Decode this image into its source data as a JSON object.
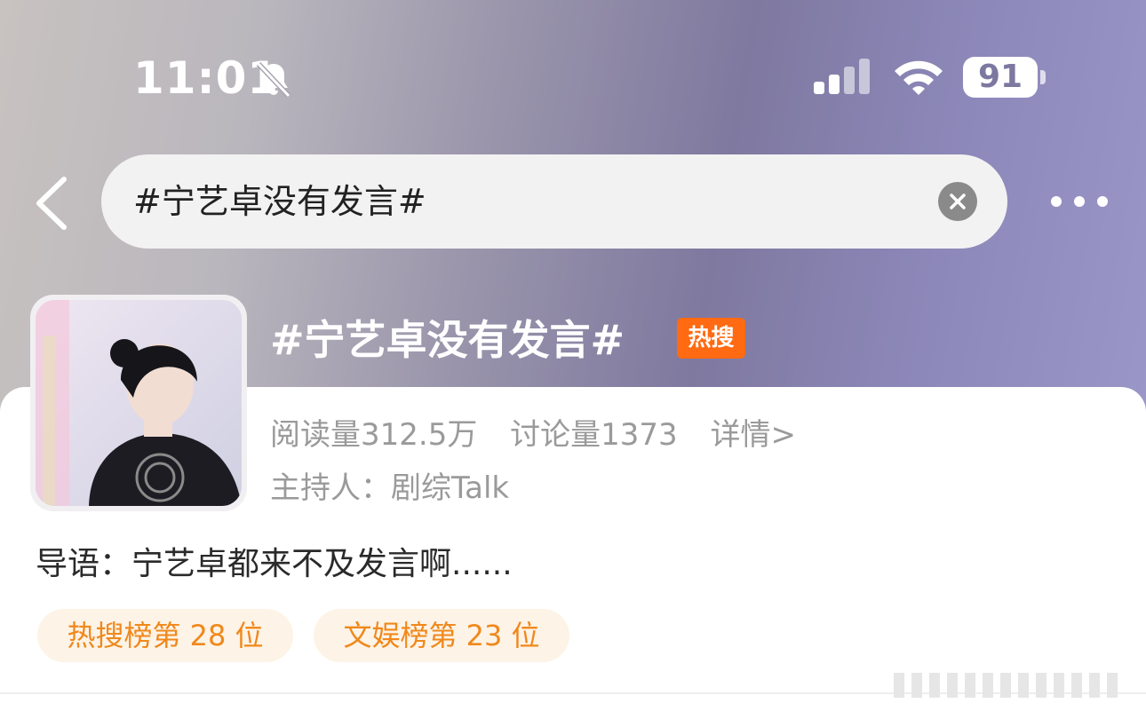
{
  "status_bar": {
    "time": "11:01",
    "battery": "91",
    "icons": [
      "bell-slash-icon",
      "signal-icon",
      "wifi-icon",
      "battery-icon"
    ]
  },
  "nav": {
    "search_text": "#宁艺卓没有发言#",
    "icons": [
      "back-icon",
      "clear-icon",
      "more-icon"
    ]
  },
  "topic": {
    "title": "#宁艺卓没有发言#",
    "badge": "热搜",
    "reads": "阅读量312.5万",
    "discussions": "讨论量1373",
    "details": "详情>",
    "host": "主持人：剧综Talk",
    "intro": "导语：宁艺卓都来不及发言啊......",
    "ranks": [
      "热搜榜第 28 位",
      "文娱榜第 23 位"
    ]
  },
  "colors": {
    "badge": "#ff6a12",
    "rank_text": "#f0881b",
    "rank_bg": "#fdf3e6"
  }
}
